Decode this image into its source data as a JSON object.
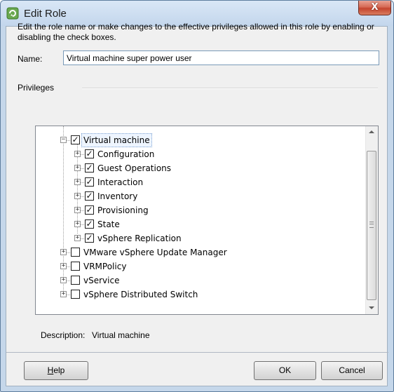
{
  "window": {
    "title": "Edit Role",
    "close_label": "X",
    "accent_color": "#c3d6ec",
    "close_color": "#c4452e"
  },
  "intro_text": "Edit the role name or make changes to the effective privileges allowed in this role by enabling or disabling the check boxes.",
  "name_field": {
    "label": "Name:",
    "value": "Virtual machine super power user"
  },
  "privileges_label": "Privileges",
  "tree": {
    "items": [
      {
        "label": "Virtual machine",
        "checked": true,
        "expanded": true,
        "selected": true
      },
      {
        "label": "Configuration",
        "checked": true,
        "expanded": false
      },
      {
        "label": "Guest Operations",
        "checked": true,
        "expanded": false
      },
      {
        "label": "Interaction",
        "checked": true,
        "expanded": false
      },
      {
        "label": "Inventory",
        "checked": true,
        "expanded": false
      },
      {
        "label": "Provisioning",
        "checked": true,
        "expanded": false
      },
      {
        "label": "State",
        "checked": true,
        "expanded": false
      },
      {
        "label": "vSphere Replication",
        "checked": true,
        "expanded": false
      },
      {
        "label": "VMware vSphere Update Manager",
        "checked": false,
        "expanded": false
      },
      {
        "label": "VRMPolicy",
        "checked": false,
        "expanded": false
      },
      {
        "label": "vService",
        "checked": false,
        "expanded": false
      },
      {
        "label": "vSphere Distributed Switch",
        "checked": false,
        "expanded": false
      }
    ]
  },
  "description": {
    "label": "Description:",
    "value": "Virtual machine"
  },
  "buttons": {
    "help_first": "H",
    "help_rest": "elp",
    "ok": "OK",
    "cancel": "Cancel"
  }
}
